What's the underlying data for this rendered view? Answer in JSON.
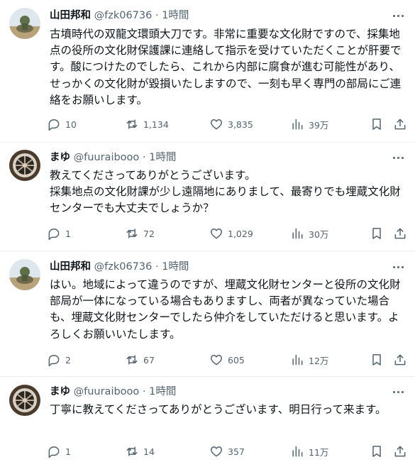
{
  "tweets": [
    {
      "name": "山田邦和",
      "handle": "@fzk06736",
      "dot": "·",
      "time": "1時間",
      "text": "古墳時代の双龍文環頭大刀です。非常に重要な文化財ですので、採集地点の役所の文化財保護課に連絡して指示を受けていただくことが肝要です。酸につけたのでしたら、これから内部に腐食が進む可能性があり、せっかくの文化財が毀損いたしますので、一刻も早く専門の部局にご連絡をお願いします。",
      "replies": "10",
      "retweets": "1,134",
      "likes": "3,835",
      "views": "39万"
    },
    {
      "name": "まゆ",
      "handle": "@fuuraibooo",
      "dot": "·",
      "time": "1時間",
      "text": "教えてくださってありがとうございます。\n採集地点の文化財課が少し遠隔地にありまして、最寄りでも埋蔵文化財センターでも大丈夫でしょうか？",
      "replies": "1",
      "retweets": "72",
      "likes": "1,029",
      "views": "30万"
    },
    {
      "name": "山田邦和",
      "handle": "@fzk06736",
      "dot": "·",
      "time": "1時間",
      "text": "はい。地域によって違うのですが、埋蔵文化財センターと役所の文化財部局が一体になっている場合もありますし、両者が異なっていた場合も、埋蔵文化財センターでしたら仲介をしていただけると思います。よろしくお願いいたします。",
      "replies": "2",
      "retweets": "67",
      "likes": "605",
      "views": "12万"
    },
    {
      "name": "まゆ",
      "handle": "@fuuraibooo",
      "dot": "·",
      "time": "1時間",
      "text": "丁寧に教えてくださってありがとうございます、明日行って来ます。",
      "replies": "1",
      "retweets": "14",
      "likes": "357",
      "views": "11万"
    }
  ],
  "icons": {
    "reply": "speech-bubble-icon",
    "retweet": "retweet-arrows-icon",
    "like": "heart-icon",
    "views": "bar-chart-icon",
    "bookmark": "bookmark-icon",
    "share": "share-upload-icon",
    "more": "three-dots-icon"
  },
  "colors": {
    "text": "#0f1419",
    "secondary": "#536471",
    "divider": "#eff3f4"
  }
}
